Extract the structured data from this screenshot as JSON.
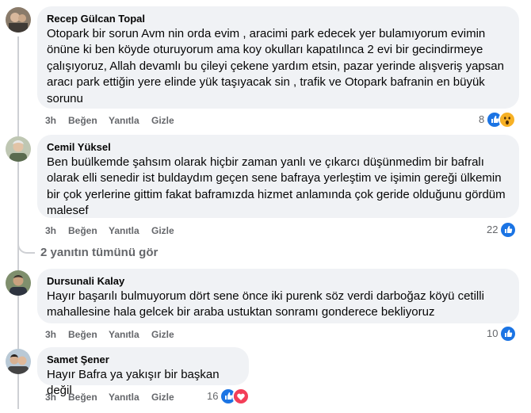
{
  "comments": [
    {
      "author": "Recep Gülcan Topal",
      "text": "Otopark bir sorun Avm nin orda evim , aracimi park edecek yer bulamıyorum evimin önüne ki ben köyde oturuyorum ama koy okulları kapatılınca 2 evi bir gecindirmeye çalışıyoruz, Allah devamlı bu çileyi çekene yardım etsin, pazar yerinde alışveriş yapsan aracı park ettiğin yere elinde yük taşıyacak sin , trafik ve Otopark bafranin en büyük sorunu",
      "time": "3h",
      "like": "Beğen",
      "reply": "Yanıtla",
      "hide": "Gizle",
      "reaction_count": "8",
      "reactions": [
        "like-icon",
        "wow-icon"
      ]
    },
    {
      "author": "Cemil Yüksel",
      "text": "Ben buülkemde şahsım olarak hiçbir zaman yanlı ve çıkarcı düşünmedim bir bafralı olarak elli senedir ist buldaydım geçen sene bafraya yerleştim ve işimin gereği ülkemin bir çok yerlerine gittim fakat baframızda hizmet anlamında çok geride olduğunu gördüm malesef",
      "time": "3h",
      "like": "Beğen",
      "reply": "Yanıtla",
      "hide": "Gizle",
      "reaction_count": "22",
      "reactions": [
        "like-icon"
      ]
    },
    {
      "author": "Dursunali Kalay",
      "text": "Hayır başarılı bulmuyorum dört sene önce iki purenk söz verdi darboğaz köyü cetilli mahallesine hala gelcek bir araba ustuktan sonramı gonderece bekliyoruz",
      "time": "3h",
      "like": "Beğen",
      "reply": "Yanıtla",
      "hide": "Gizle",
      "reaction_count": "10",
      "reactions": [
        "like-icon"
      ]
    },
    {
      "author": "Samet Şener",
      "text": "Hayır Bafra ya yakışır bir başkan değil",
      "time": "3h",
      "like": "Beğen",
      "reply": "Yanıtla",
      "hide": "Gizle",
      "reaction_count": "16",
      "reactions": [
        "like-icon",
        "love-icon"
      ]
    }
  ],
  "more_replies_label": "2 yanıtın tümünü gör",
  "colors": {
    "like": "#1b74e4",
    "love": "#f33e58",
    "wow": "#f7b125",
    "bubble": "#f0f2f5",
    "meta": "#65676b"
  }
}
